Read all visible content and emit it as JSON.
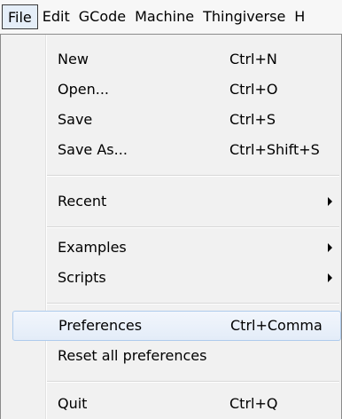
{
  "menubar": {
    "items": [
      {
        "label": "File"
      },
      {
        "label": "Edit"
      },
      {
        "label": "GCode"
      },
      {
        "label": "Machine"
      },
      {
        "label": "Thingiverse"
      },
      {
        "label": "H"
      }
    ]
  },
  "file_menu": {
    "new": {
      "label": "New",
      "shortcut": "Ctrl+N"
    },
    "open": {
      "label": "Open...",
      "shortcut": "Ctrl+O"
    },
    "save": {
      "label": "Save",
      "shortcut": "Ctrl+S"
    },
    "save_as": {
      "label": "Save As...",
      "shortcut": "Ctrl+Shift+S"
    },
    "recent": {
      "label": "Recent"
    },
    "examples": {
      "label": "Examples"
    },
    "scripts": {
      "label": "Scripts"
    },
    "preferences": {
      "label": "Preferences",
      "shortcut": "Ctrl+Comma"
    },
    "reset_preferences": {
      "label": "Reset all preferences"
    },
    "quit": {
      "label": "Quit",
      "shortcut": "Ctrl+Q"
    }
  }
}
